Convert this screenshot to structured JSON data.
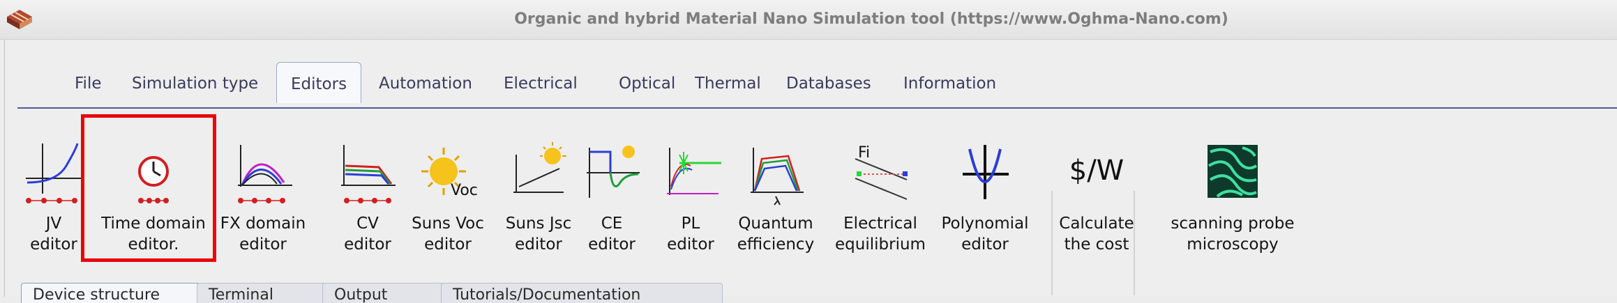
{
  "window": {
    "title": "Organic and hybrid Material Nano Simulation tool (https://www.Oghma-Nano.com)",
    "app_icon": "oghma-app-icon"
  },
  "ribbon": {
    "tabs": [
      {
        "label": "File"
      },
      {
        "label": "Simulation type"
      },
      {
        "label": "Editors",
        "active": true
      },
      {
        "label": "Automation"
      },
      {
        "label": "Electrical"
      },
      {
        "label": "Optical"
      },
      {
        "label": "Thermal"
      },
      {
        "label": "Databases"
      },
      {
        "label": "Information"
      }
    ],
    "accent_color": "#4d5b93"
  },
  "toolbar": {
    "tools": [
      {
        "label": "JV\neditor",
        "icon": "jv-curve-icon"
      },
      {
        "label": "Time domain\neditor.",
        "icon": "clock-icon",
        "highlighted": true
      },
      {
        "label": "FX domain\neditor",
        "icon": "fx-domain-icon"
      },
      {
        "label": "CV\neditor",
        "icon": "cv-curve-icon"
      },
      {
        "label": "Suns Voc\neditor",
        "icon": "sun-voc-icon",
        "icon_text": "Voc"
      },
      {
        "label": "Suns Jsc\neditor",
        "icon": "sun-jsc-icon"
      },
      {
        "label": "CE\neditor",
        "icon": "ce-transient-icon"
      },
      {
        "label": "PL\neditor",
        "icon": "pl-icon"
      },
      {
        "label": "Quantum\nefficiency",
        "icon": "quantum-efficiency-icon"
      },
      {
        "label": "Electrical\nequilibrium",
        "icon": "fermi-level-icon",
        "icon_text": "Fi"
      },
      {
        "label": "Polynomial\neditor",
        "icon": "polynomial-icon"
      },
      {
        "label": "Calculate\nthe cost",
        "icon": "cost-icon",
        "icon_text": "$/W"
      },
      {
        "label": "scanning probe\nmicroscopy",
        "icon": "spm-image-icon"
      }
    ],
    "highlight_color": "#e8050b"
  },
  "bottom_tabs": [
    {
      "label": "Device structure",
      "active": true
    },
    {
      "label": "Terminal"
    },
    {
      "label": "Output"
    },
    {
      "label": "Tutorials/Documentation"
    }
  ]
}
